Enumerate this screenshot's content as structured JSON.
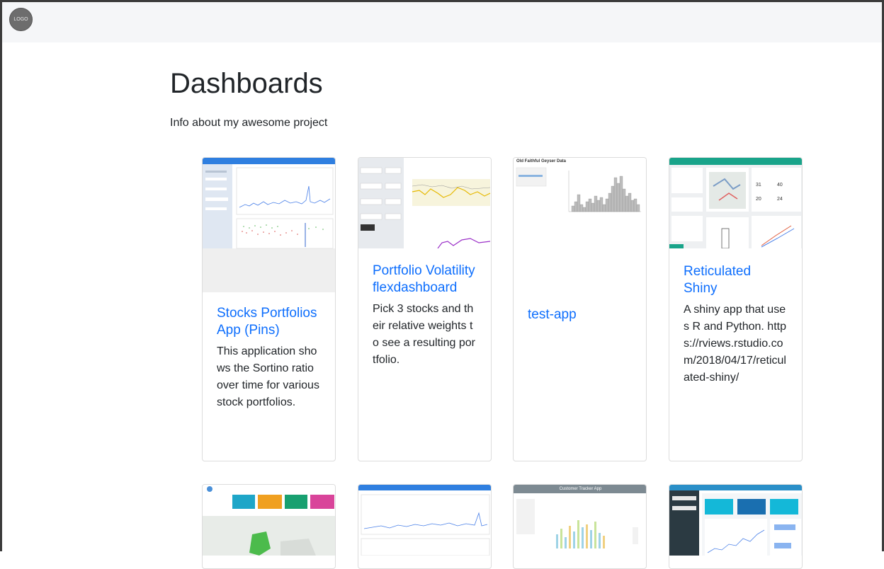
{
  "navbar": {
    "logo_text": "LOGO"
  },
  "header": {
    "title": "Dashboards",
    "subtitle": "Info about my awesome project"
  },
  "cards": [
    {
      "title": "Stocks Portfolios App (Pins)",
      "description": "This application shows the Sortino ratio over time for various stock portfolios."
    },
    {
      "title": "Portfolio Volatility flexdashboard",
      "description": "Pick 3 stocks and their relative weights to see a resulting portfolio."
    },
    {
      "title": "test-app",
      "description": "",
      "thumb_title": "Old Faithful Geyser Data"
    },
    {
      "title": "Reticulated Shiny",
      "description": "A shiny app that uses R and Python. https://rviews.rstudio.com/2018/04/17/reticulated-shiny/"
    }
  ],
  "second_row": {
    "card3_thumb_title": "Customer Tracker App"
  }
}
